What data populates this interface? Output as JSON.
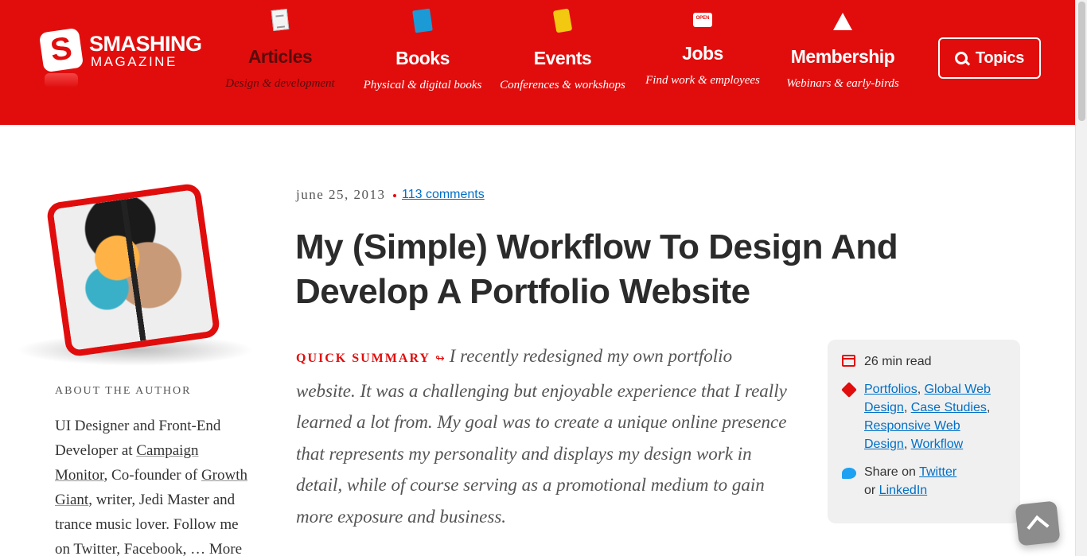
{
  "brand": {
    "title": "SMASHING",
    "subtitle": "MAGAZINE",
    "mark": "S"
  },
  "nav": [
    {
      "label": "Articles",
      "sub": "Design & development",
      "icon": "document-icon",
      "active": true
    },
    {
      "label": "Books",
      "sub": "Physical & digital books",
      "icon": "book-icon"
    },
    {
      "label": "Events",
      "sub": "Conferences & workshops",
      "icon": "ticket-icon"
    },
    {
      "label": "Jobs",
      "sub": "Find work & employees",
      "icon": "open-sign-icon",
      "sign_text": "OPEN"
    },
    {
      "label": "Membership",
      "sub": "Webinars & early-birds",
      "icon": "boat-icon"
    }
  ],
  "topics_button": {
    "label": "Topics",
    "icon": "search-icon"
  },
  "author": {
    "about_label": "ABOUT THE AUTHOR",
    "bio_1": "UI Designer and Front-End Developer at ",
    "link_1": "Campaign Monitor",
    "bio_2": ", Co-founder of ",
    "link_2": "Growth Giant",
    "bio_3": ", writer, Jedi Master and trance music lover. Follow me on Twitter, Facebook, … ",
    "more": "More"
  },
  "article": {
    "date": "june 25, 2013",
    "comments": "113 comments",
    "title": "My (Simple) Workflow To Design And Develop A Portfolio Website",
    "summary_label": "QUICK SUMMARY",
    "summary_arrow": "↬",
    "summary": "I recently redesigned my own portfolio website. It was a challenging but enjoyable experience that I really learned a lot from. My goal was to create a unique online presence that represents my personality and displays my design work in detail, while of course serving as a promotional medium to gain more exposure and business."
  },
  "meta": {
    "read_time": "26 min read",
    "tags": [
      "Portfolios",
      "Global Web Design",
      "Case Studies",
      "Responsive Web Design",
      "Workflow"
    ],
    "share_prefix": "Share on ",
    "share_twitter": "Twitter",
    "share_or": "or ",
    "share_linkedin": "LinkedIn"
  },
  "colors": {
    "brand_red": "#e10d0d",
    "link_blue": "#006fc6",
    "meta_bg": "#f0f0f0"
  }
}
